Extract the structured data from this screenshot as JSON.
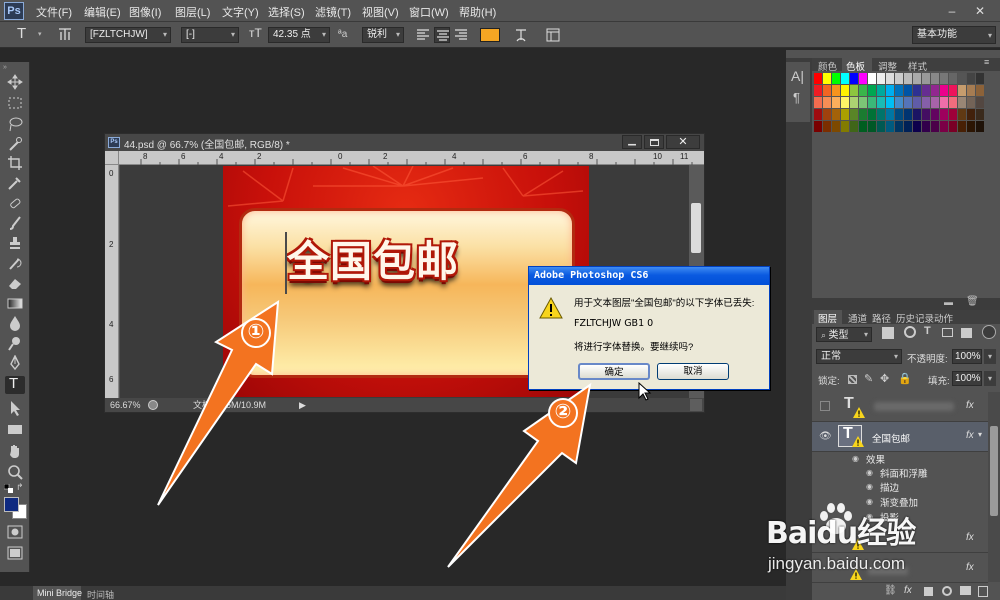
{
  "app": {
    "logo": "Ps"
  },
  "menu": [
    "文件(F)",
    "编辑(E)",
    "图像(I)",
    "图层(L)",
    "文字(Y)",
    "选择(S)",
    "滤镜(T)",
    "视图(V)",
    "窗口(W)",
    "帮助(H)"
  ],
  "window_buttons": {
    "minimize": "–",
    "close": "✕"
  },
  "options": {
    "font_family": "[FZLTCHJW]",
    "font_style": "[-]",
    "font_size": "42.35 点",
    "aa_label": "ªa",
    "antialias": "锐利",
    "workspace": "基本功能",
    "text_color": "#f5a623"
  },
  "document": {
    "title": "44.psd @ 66.7% (全国包邮, RGB/8) *",
    "ruler_h": [
      "8",
      "6",
      "4",
      "2",
      "0",
      "2",
      "4",
      "6",
      "8",
      "10",
      "11"
    ],
    "ruler_v": [
      "0",
      "2",
      "4",
      "6"
    ],
    "zoom": "66.67%",
    "status": "文档:3.56M/10.9M",
    "banner_text": "全国包邮"
  },
  "dialog": {
    "title": "Adobe Photoshop CS6",
    "message": "用于文本图层\"全国包邮\"的以下字体已丢失:",
    "font": "FZLTCHJW  GB1 0",
    "question": "将进行字体替换。要继续吗?",
    "ok": "确定",
    "cancel": "取消"
  },
  "annotations": {
    "one": "①",
    "two": "②"
  },
  "swatches": {
    "tabs": [
      "颜色",
      "色板",
      "调整",
      "样式"
    ]
  },
  "layers": {
    "tabs": [
      "图层",
      "通道",
      "路径",
      "历史记录",
      "动作"
    ],
    "filter": "类型",
    "blend": "正常",
    "opacity_label": "不透明度:",
    "opacity": "100%",
    "lock_label": "锁定:",
    "fill_label": "填充:",
    "fill": "100%",
    "layer_name": "全国包邮",
    "effects_label": "效果",
    "effects": [
      "斜面和浮雕",
      "描边",
      "渐变叠加",
      "投影"
    ]
  },
  "bottom_tabs": [
    "Mini Bridge",
    "时间轴"
  ],
  "watermark": {
    "brand": "Baidu经验",
    "url": "jingyan.baidu.com"
  }
}
